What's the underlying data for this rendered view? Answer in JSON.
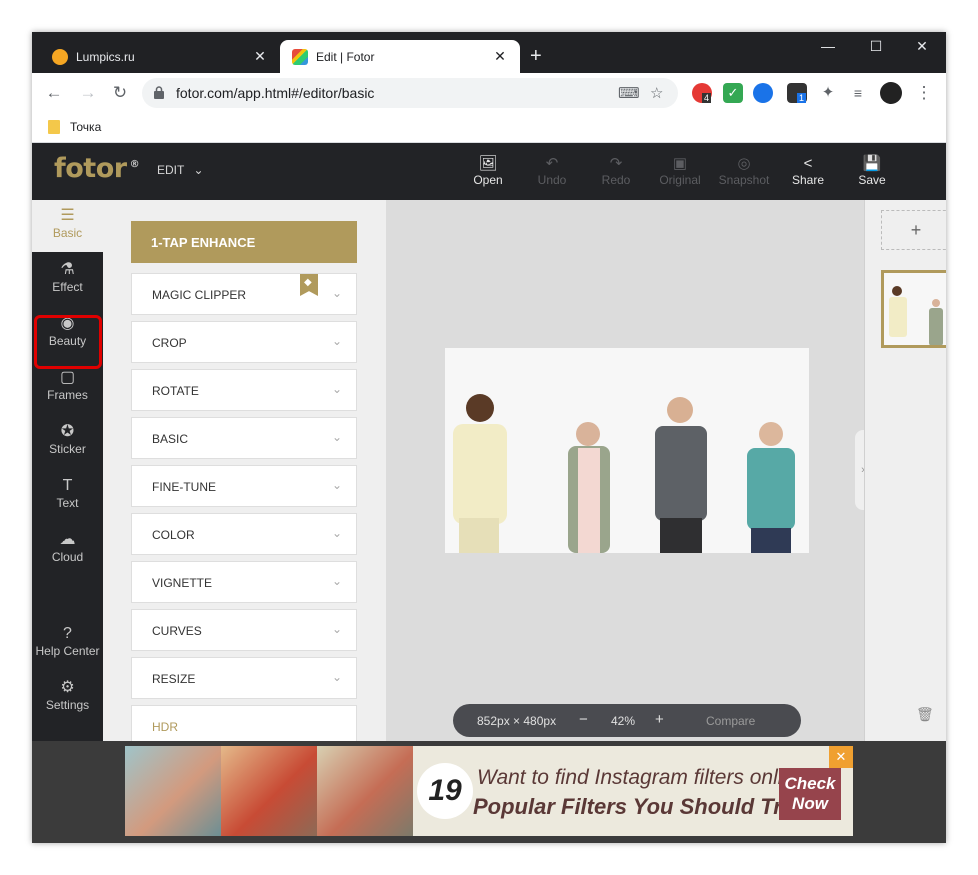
{
  "browser": {
    "tabs": [
      {
        "title": "Lumpics.ru",
        "active": false,
        "favicon_color": "#f5a623"
      },
      {
        "title": "Edit | Fotor",
        "active": true,
        "favicon_color": "#e74c3c"
      }
    ],
    "url": "fotor.com/app.html#/editor/basic",
    "bookmark": "Точка",
    "extension_badges": {
      "opera": "4",
      "cube": "1"
    }
  },
  "app": {
    "logo": "fotor",
    "logo_mark": "®",
    "edit_menu": "EDIT",
    "toolbar": [
      {
        "label": "Open",
        "enabled": true,
        "icon": "image-icon"
      },
      {
        "label": "Undo",
        "enabled": false,
        "icon": "undo-icon"
      },
      {
        "label": "Redo",
        "enabled": false,
        "icon": "redo-icon"
      },
      {
        "label": "Original",
        "enabled": false,
        "icon": "original-icon"
      },
      {
        "label": "Snapshot",
        "enabled": false,
        "icon": "snapshot-icon"
      },
      {
        "label": "Share",
        "enabled": true,
        "icon": "share-icon"
      },
      {
        "label": "Save",
        "enabled": true,
        "icon": "save-icon"
      }
    ],
    "sidebar": [
      {
        "label": "Basic",
        "icon": "sliders-icon",
        "active": true
      },
      {
        "label": "Effect",
        "icon": "flask-icon",
        "active": false
      },
      {
        "label": "Beauty",
        "icon": "eye-icon",
        "active": false
      },
      {
        "label": "Frames",
        "icon": "frame-icon",
        "active": false
      },
      {
        "label": "Sticker",
        "icon": "star-icon",
        "active": false
      },
      {
        "label": "Text",
        "icon": "text-icon",
        "active": false
      },
      {
        "label": "Cloud",
        "icon": "cloud-icon",
        "active": false
      },
      {
        "label": "Help Center",
        "icon": "help-icon",
        "active": false
      },
      {
        "label": "Settings",
        "icon": "gear-icon",
        "active": false
      }
    ],
    "panel": {
      "enhance_label": "1-TAP ENHANCE",
      "items": [
        "MAGIC CLIPPER",
        "CROP",
        "ROTATE",
        "BASIC",
        "FINE-TUNE",
        "COLOR",
        "VIGNETTE",
        "CURVES",
        "RESIZE",
        "HDR"
      ]
    },
    "zoom": {
      "dimensions": "852px × 480px",
      "minus": "−",
      "level": "42%",
      "plus": "+",
      "compare": "Compare"
    },
    "ad": {
      "number": "19",
      "line1": "Want to find Instagram filters online?",
      "line2": "Popular Filters You Should Try",
      "cta_line1": "Check",
      "cta_line2": "Now",
      "close": "✕"
    },
    "colors": {
      "accent": "#b09a5c",
      "dark": "#222326",
      "highlight": "#e00000"
    }
  }
}
